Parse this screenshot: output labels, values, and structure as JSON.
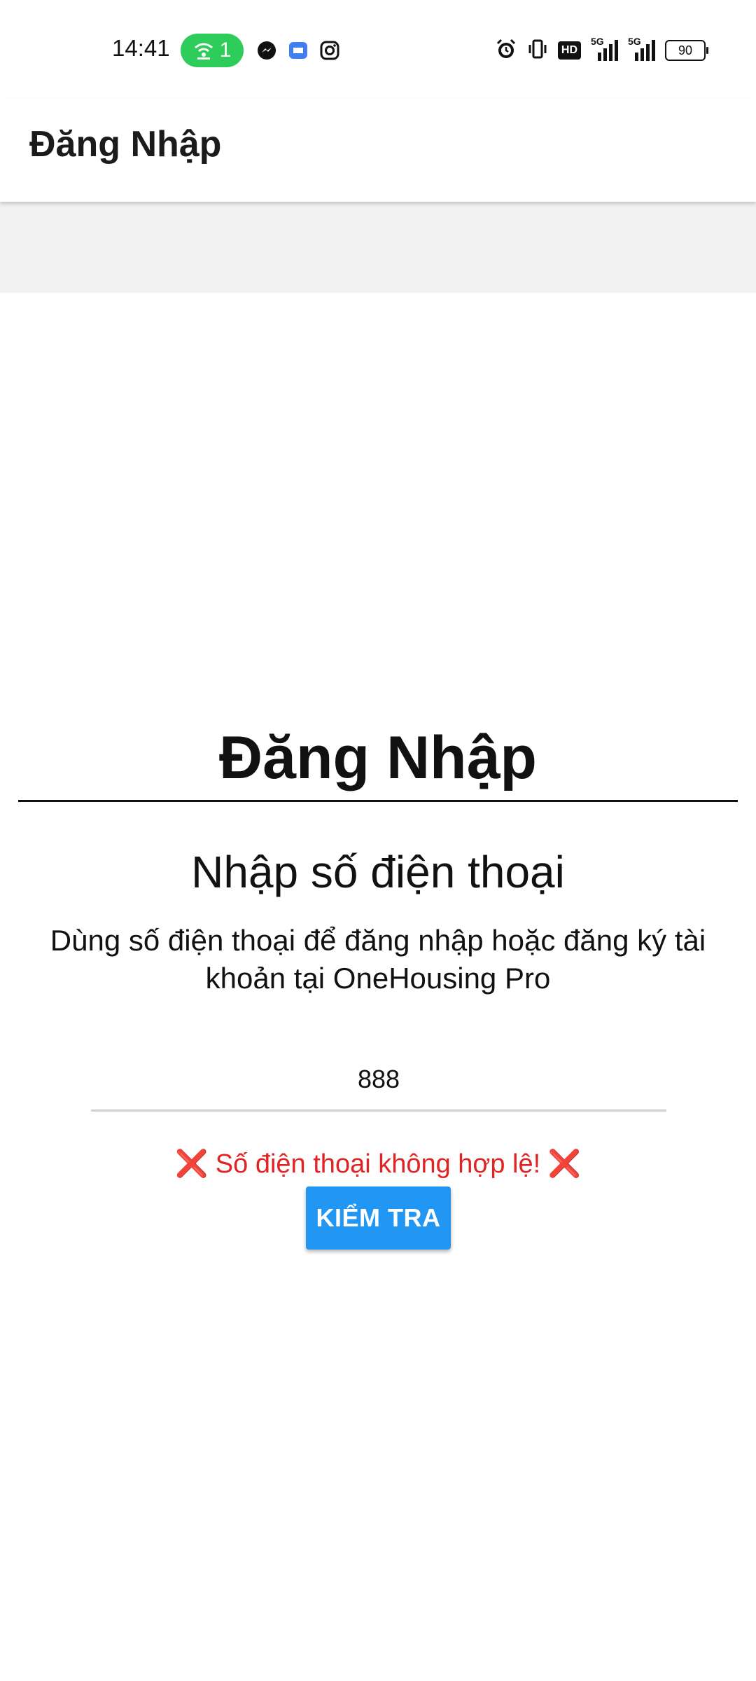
{
  "status_bar": {
    "time": "14:41",
    "hotspot_count": "1",
    "network_labels": [
      "5G",
      "5G"
    ],
    "hd_label": "HD",
    "battery": "90",
    "icons": [
      "wifi-hotspot-icon",
      "messenger-icon",
      "message-icon",
      "instagram-icon",
      "alarm-icon",
      "vibrate-icon",
      "hd-icon",
      "signal-5g-icon",
      "signal-5g-icon-2",
      "battery-icon"
    ]
  },
  "app_bar": {
    "title": "Đăng Nhập"
  },
  "login": {
    "heading": "Đăng Nhập",
    "subheading": "Nhập số điện thoại",
    "description": "Dùng số điện thoại để đăng nhập hoặc đăng ký tài khoản tại OneHousing Pro",
    "phone_value": "888",
    "error": "❌ Số điện thoại không hợp lệ! ❌",
    "button_label": "KIỂM TRA"
  },
  "colors": {
    "accent": "#2196f3",
    "error": "#e02424",
    "hotspot": "#2ecc5a",
    "band": "#f1f1f1"
  }
}
